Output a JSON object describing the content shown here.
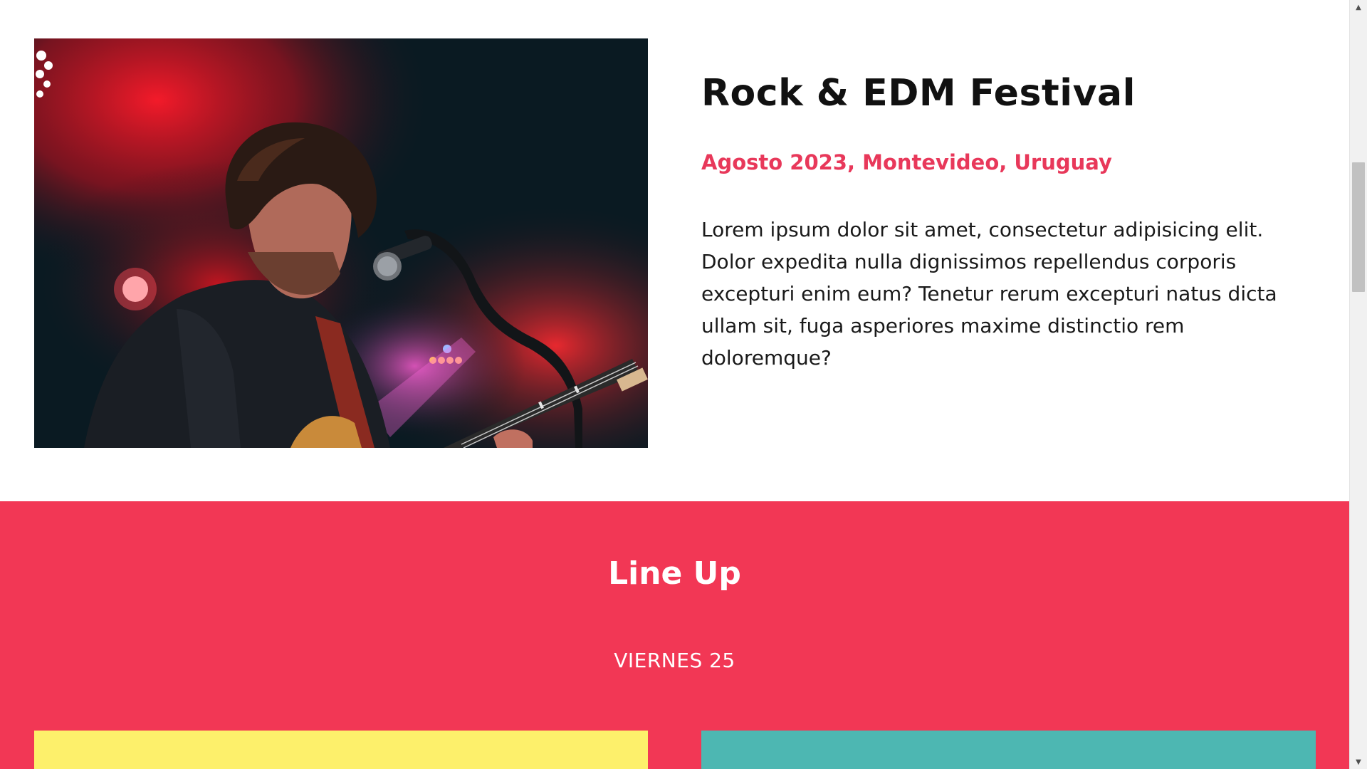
{
  "festival": {
    "title": "Rock & EDM Festival",
    "date_location": "Agosto 2023, Montevideo, Uruguay",
    "description": "Lorem ipsum dolor sit amet, consectetur adipisicing elit. Dolor expedita nulla dignissimos repellendus corporis excepturi enim eum? Tenetur rerum excepturi natus dicta ullam sit, fuga asperiores maxime distinctio rem doloremque?",
    "photo_icon": "singer-guitarist-photo"
  },
  "lineup": {
    "heading": "Line Up",
    "day_label": "VIERNES 25",
    "cards": [
      {
        "color": "#fdf06b"
      },
      {
        "color": "#4db7b2"
      }
    ]
  },
  "colors": {
    "accent": "#e8385a",
    "lineup_background": "#f23755",
    "text": "#111111"
  },
  "scrollbar": {
    "up_icon": "chevron-up-icon",
    "down_icon": "chevron-down-icon"
  }
}
